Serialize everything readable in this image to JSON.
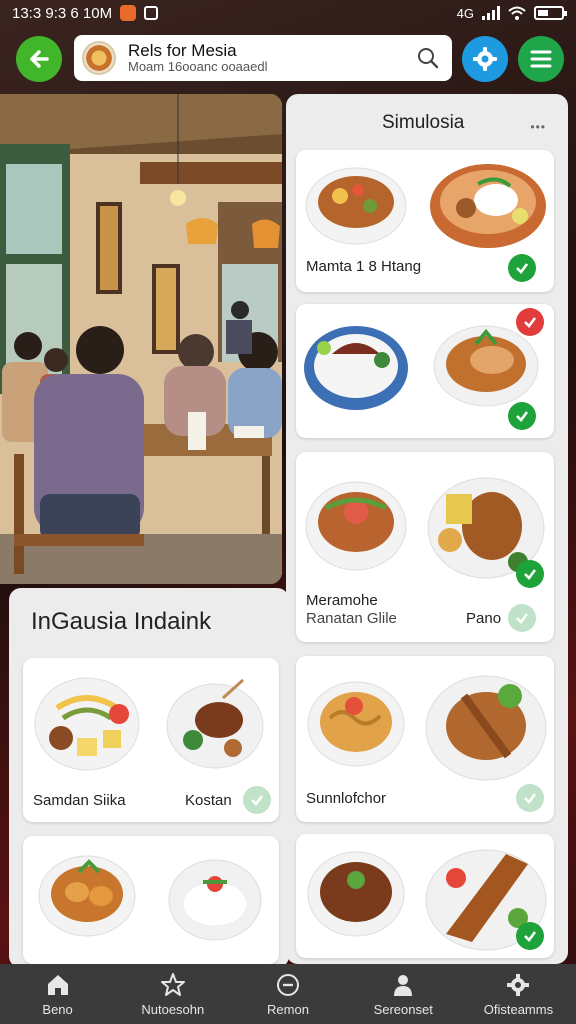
{
  "status": {
    "time": "13:3 9:3 6 10M"
  },
  "search": {
    "title": "Rels for Mesia",
    "subtitle": "Moam 16ooanc ooaaedl"
  },
  "simulosia": {
    "title": "Simulosia",
    "more": "•••",
    "cards": [
      {
        "label": "Mamta 1 8 Htang"
      },
      {
        "label": ""
      },
      {
        "label_line1": "Meramohe",
        "label_line2": "Ranatan Glile",
        "label_right": "Pano"
      },
      {
        "label": "Sunnlofchor"
      },
      {
        "label": ""
      }
    ]
  },
  "indonesia": {
    "title": "InGausia Indaink",
    "cards": [
      {
        "label_left": "Samdan Siika",
        "label_right": "Kostan"
      },
      {
        "label": ""
      }
    ]
  },
  "nav": [
    {
      "label": "Beno",
      "icon": "home-icon"
    },
    {
      "label": "Nutoesohn",
      "icon": "star-icon"
    },
    {
      "label": "Remon",
      "icon": "minus-circle-icon"
    },
    {
      "label": "Sereonset",
      "icon": "person-icon"
    },
    {
      "label": "Ofisteamms",
      "icon": "gear-icon"
    }
  ],
  "colors": {
    "accent_green": "#1ea33a",
    "settings_blue": "#1e9be0",
    "check_red": "#e23b3b"
  }
}
